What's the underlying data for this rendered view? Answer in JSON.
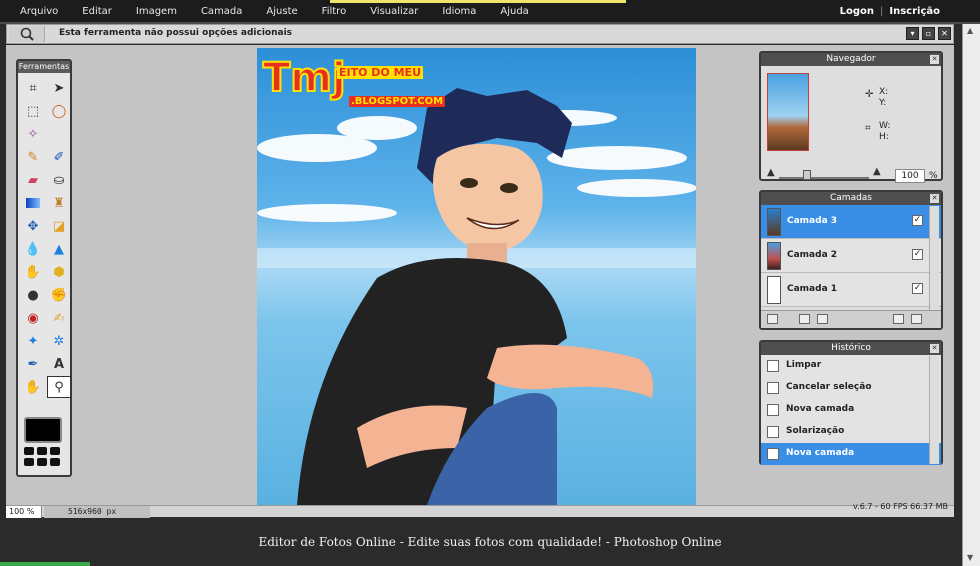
{
  "menu": {
    "items": [
      "Arquivo",
      "Editar",
      "Imagem",
      "Camada",
      "Ajuste",
      "Filtro",
      "Visualizar",
      "Idioma",
      "Ajuda"
    ],
    "login": "Logon",
    "separator": "|",
    "signup": "Inscrição"
  },
  "options_bar": {
    "message": "Esta ferramenta não possui opções adicionais"
  },
  "toolbox": {
    "title": "Ferramentas"
  },
  "canvas": {
    "logo_text": "Tmj",
    "logo_subtitle": "EITO DO MEU",
    "logo_url": ".BLOGSPOT.COM"
  },
  "navigator": {
    "title": "Navegador",
    "x_label": "X:",
    "y_label": "Y:",
    "w_label": "W:",
    "h_label": "H:",
    "zoom": "100",
    "percent": "%"
  },
  "layers": {
    "title": "Camadas",
    "items": [
      {
        "name": "Camada 3",
        "active": true
      },
      {
        "name": "Camada 2",
        "active": false
      },
      {
        "name": "Camada 1",
        "active": false
      }
    ],
    "check": "✓"
  },
  "history": {
    "title": "Histórico",
    "items": [
      {
        "label": "Limpar"
      },
      {
        "label": "Cancelar seleção"
      },
      {
        "label": "Nova camada"
      },
      {
        "label": "Solarização"
      },
      {
        "label": "Nova camada"
      }
    ]
  },
  "status": {
    "zoom": "100 %",
    "dimensions": "516x960 px",
    "performance": "v.6.7 - 60 FPS 66.37 MB"
  },
  "caption": {
    "text": "Editor de Fotos Online - Edite suas fotos com qualidade! - Photoshop Online"
  },
  "colors": {
    "accent": "#3b8ee6",
    "menubar": "#1c1c1c",
    "workspace": "#c4c4c4"
  }
}
